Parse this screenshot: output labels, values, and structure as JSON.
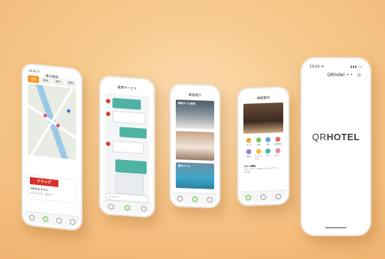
{
  "colors": {
    "bg": "#f7c98c",
    "accent_orange": "#f39a2e",
    "accent_teal": "#4fb3a4",
    "accent_red": "#d83a2c"
  },
  "phone1": {
    "status": "19:02 4",
    "title": "周辺施設",
    "tabs": [
      "全部",
      "飲食",
      "観光",
      "買物"
    ],
    "card_logo": "ドラッグ",
    "card_title": "乌鹤可盖 木/%6",
    "card_sub": "10:00-21:00 · 徒歩5分",
    "icons": [
      "home-icon",
      "map-icon",
      "user-icon",
      "settings-icon"
    ]
  },
  "phone2": {
    "title": "客室サービス",
    "input_placeholder": "メッセージ"
  },
  "phone3": {
    "title": "客室紹介",
    "photo1_label": "禁煙ダブル客室",
    "photo3_label": "室内プール"
  },
  "phone4": {
    "title": "施設案内",
    "services": [
      "フロント",
      "清掃",
      "周辺",
      "館内案内",
      "朝食",
      "チェックアウト",
      "Wi-Fi",
      "タクシー"
    ],
    "info_title": "ホテル情報",
    "info_text": "チェックイン 15:00 · チェックアウト 11:00"
  },
  "phone5": {
    "status": "19:02 ≠",
    "title": "QRhotel",
    "brand_qr": "QR",
    "brand_hotel": "HOTEL"
  }
}
